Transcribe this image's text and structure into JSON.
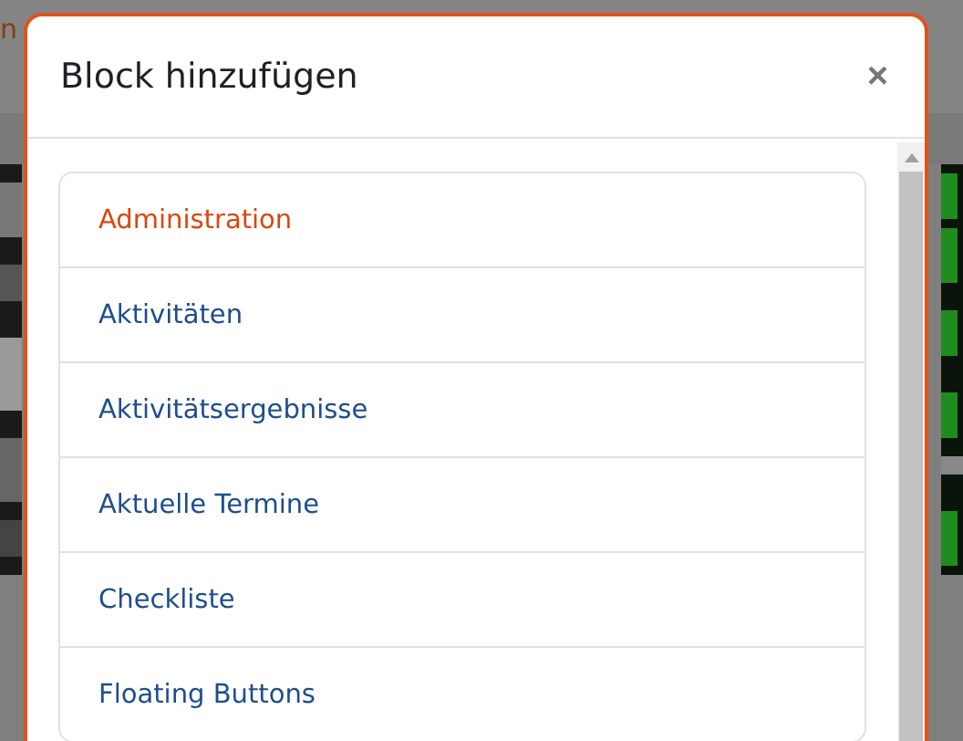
{
  "background": {
    "link_fragment": "n"
  },
  "dialog": {
    "title": "Block hinzufügen",
    "close": "×",
    "items": [
      {
        "label": "Administration",
        "selected": true
      },
      {
        "label": "Aktivitäten",
        "selected": false
      },
      {
        "label": "Aktivitätsergebnisse",
        "selected": false
      },
      {
        "label": "Aktuelle Termine",
        "selected": false
      },
      {
        "label": "Checkliste",
        "selected": false
      },
      {
        "label": "Floating Buttons",
        "selected": false
      }
    ]
  }
}
